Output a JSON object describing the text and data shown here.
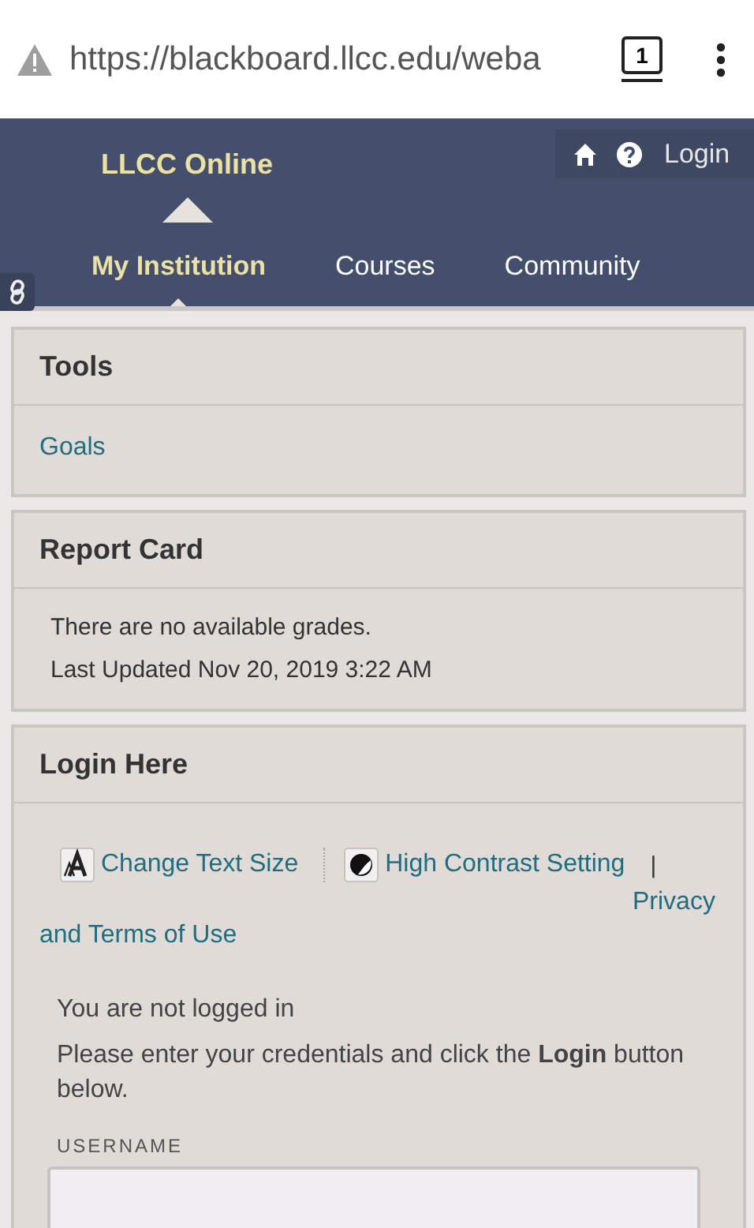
{
  "browser": {
    "url": "https://blackboard.llcc.edu/weba",
    "tab_count": "1"
  },
  "header": {
    "title": "LLCC Online",
    "utility_link": "Login"
  },
  "tabs": [
    {
      "label": "My Institution",
      "selected": true
    },
    {
      "label": "Courses",
      "selected": false
    },
    {
      "label": "Community",
      "selected": false
    }
  ],
  "modules": [
    {
      "kind": "links",
      "title": "Tools",
      "items": [
        "Goals"
      ]
    },
    {
      "kind": "text",
      "title": "Report Card",
      "lines": [
        "There are no available grades.",
        "Last Updated Nov 20, 2019 3:22 AM"
      ]
    },
    {
      "kind": "login",
      "title": "Login Here",
      "accessibility": [
        {
          "label": "Change Text Size",
          "kind": "text-size"
        },
        {
          "label": "High Contrast Setting",
          "kind": "contrast"
        }
      ],
      "separator": "|",
      "privacy": "Privacy and Terms of Use",
      "status": "You are not logged in",
      "instructions": "Please enter your credentials and click the **Login** button below.",
      "field_label": "USERNAME"
    }
  ]
}
